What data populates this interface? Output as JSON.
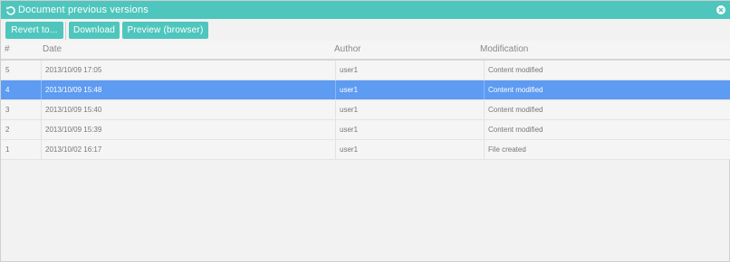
{
  "window": {
    "title": "Document previous versions",
    "title_icon": "history-icon",
    "close_icon": "close-icon"
  },
  "toolbar": {
    "revert_label": "Revert to...",
    "download_label": "Download",
    "preview_label": "Preview (browser)"
  },
  "table": {
    "columns": [
      "#",
      "Date",
      "Author",
      "Modification"
    ],
    "rows": [
      {
        "num": "5",
        "date": "2013/10/09 17:05",
        "author": "user1",
        "modification": "Content modified",
        "selected": false
      },
      {
        "num": "4",
        "date": "2013/10/09 15:48",
        "author": "user1",
        "modification": "Content modified",
        "selected": true
      },
      {
        "num": "3",
        "date": "2013/10/09 15:40",
        "author": "user1",
        "modification": "Content modified",
        "selected": false
      },
      {
        "num": "2",
        "date": "2013/10/09 15:39",
        "author": "user1",
        "modification": "Content modified",
        "selected": false
      },
      {
        "num": "1",
        "date": "2013/10/02 16:17",
        "author": "user1",
        "modification": "File created",
        "selected": false
      }
    ]
  },
  "colors": {
    "accent": "#4fc6bd",
    "selection": "#5e9bf2"
  }
}
